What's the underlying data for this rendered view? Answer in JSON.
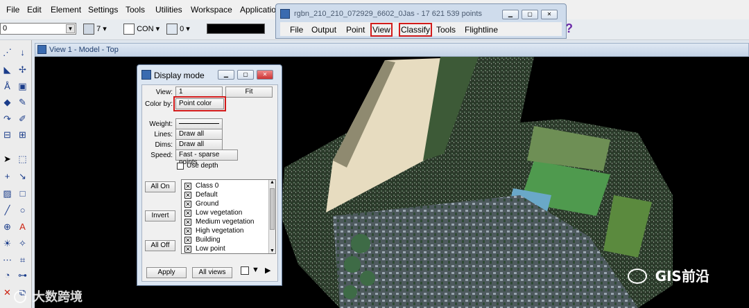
{
  "main_menu": [
    "File",
    "Edit",
    "Element",
    "Settings",
    "Tools",
    "Utilities",
    "Workspace",
    "Applicatio"
  ],
  "toolbar": {
    "level_value": "0",
    "color_value": "7",
    "style_value": "CON",
    "weight_value": "0",
    "help_glyph": "?"
  },
  "view_window": {
    "title": "View 1 - Model - Top"
  },
  "classify_window": {
    "title": "rgbn_210_210_072929_6602_0Jas - 17 621 539 points",
    "menu": [
      "File",
      "Output",
      "Point",
      "View",
      "Classify",
      "Tools",
      "Flightline"
    ],
    "highlighted": [
      "View",
      "Classify"
    ],
    "highlight_color": "#d21a1a"
  },
  "display_mode": {
    "title": "Display mode",
    "view_label": "View:",
    "view_value": "1",
    "fit_label": "Fit",
    "colorby_label": "Color by:",
    "colorby_value": "Point color",
    "weight_label": "Weight:",
    "lines_label": "Lines:",
    "lines_value": "Draw all",
    "dims_label": "Dims:",
    "dims_value": "Draw all",
    "speed_label": "Speed:",
    "speed_value": "Fast - sparse points",
    "use_depth_label": "Use depth",
    "all_on_label": "All On",
    "invert_label": "Invert",
    "all_off_label": "All Off",
    "classes": [
      "Class 0",
      "Default",
      "Ground",
      "Low vegetation",
      "Medium vegetation",
      "High vegetation",
      "Building",
      "Low point"
    ],
    "apply_label": "Apply",
    "all_views_label": "All views"
  },
  "watermarks": {
    "bottom_left": "大数跨境",
    "bottom_right": "GIS前沿"
  }
}
